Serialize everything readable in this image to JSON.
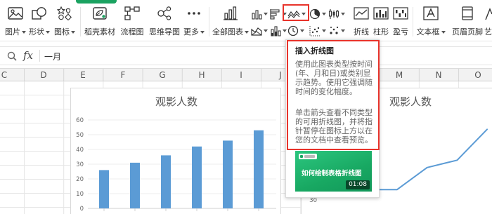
{
  "ribbon": {
    "picture": {
      "label": "图片",
      "icon": "picture-icon"
    },
    "shape": {
      "label": "形状",
      "icon": "shape-icon"
    },
    "icons": {
      "label": "图标",
      "icon": "icon-library-icon"
    },
    "docer": {
      "label": "稻壳素材",
      "icon": "docer-material-icon"
    },
    "flowchart": {
      "label": "流程图",
      "icon": "flowchart-icon"
    },
    "mindmap": {
      "label": "思维导图",
      "icon": "mindmap-icon"
    },
    "more": {
      "label": "更多",
      "icon": "more-icon"
    },
    "all_charts": {
      "label": "全部图表",
      "icon": "all-charts-icon"
    },
    "chart_gallery": [
      "column-chart-icon",
      "bar-chart-icon",
      "line-chart-icon",
      "pie-chart-icon",
      "stock-chart-icon",
      "area-chart-icon",
      "stacked-column-icon",
      "donut-chart-icon",
      "scatter-chart-icon",
      "bubble-chart-icon"
    ],
    "sparkline_line": {
      "label": "折线",
      "icon": "sparkline-line-icon"
    },
    "sparkline_column": {
      "label": "柱形",
      "icon": "sparkline-column-icon"
    },
    "sparkline_winloss": {
      "label": "盈亏",
      "icon": "sparkline-winloss-icon"
    },
    "textbox": {
      "label": "文本框",
      "icon": "textbox-icon"
    },
    "header_footer": {
      "label": "页眉页脚",
      "icon": "header-footer-icon"
    },
    "art_text": {
      "label": "艺",
      "icon": "art-text-icon"
    }
  },
  "formula_bar": {
    "fx_label": "fx",
    "content": "一月"
  },
  "column_headers": {
    "left": [
      "C",
      "D",
      "E",
      "F",
      "G",
      "H",
      "I",
      "J"
    ],
    "right": [
      "M",
      "N",
      "O"
    ]
  },
  "tooltip": {
    "title": "插入折线图",
    "paragraph1": "使用此图表类型按时间(年、月和日)或类别显示趋势。使用它强调随时间的变化幅度。",
    "paragraph2": "单击箭头查看不同类型的可用折线图，并将指针暂停在图标上方以在您的文档中查看预览。",
    "video": {
      "title": "如何绘制表格折线图",
      "duration": "01:08"
    }
  },
  "colors": {
    "series": "#5b9bd5",
    "highlight": "#e8332b",
    "accent_green": "#1aa260",
    "gridline": "#eeeeee"
  },
  "chart_data": [
    {
      "type": "bar",
      "title": "观影人数",
      "xlabel": "",
      "ylabel": "",
      "values": [
        26,
        31,
        36,
        42,
        46,
        53
      ],
      "ylim": [
        0,
        60
      ],
      "yticks": [
        0,
        10,
        20,
        30,
        40,
        50,
        60
      ],
      "grid": false,
      "legend": "none"
    },
    {
      "type": "line",
      "title": "观影人数",
      "xlabel": "",
      "ylabel": "",
      "values": [
        37,
        37,
        52,
        57,
        78
      ],
      "yticks": [
        30
      ],
      "grid": false,
      "legend": "none"
    }
  ]
}
